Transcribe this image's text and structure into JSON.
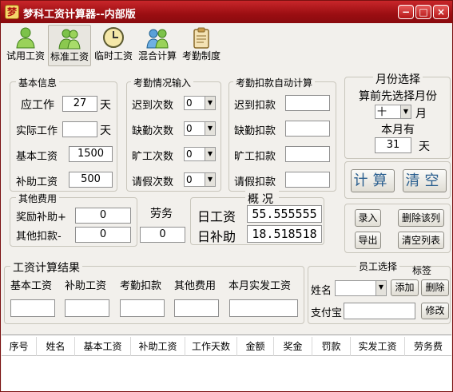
{
  "window": {
    "title": "梦科工资计算器--内部版",
    "app_icon_char": "梦",
    "controls": [
      "−",
      "□",
      "×"
    ]
  },
  "toolbar": [
    {
      "label": "试用工资",
      "icon": "person-icon"
    },
    {
      "label": "标准工资",
      "icon": "two-people-icon"
    },
    {
      "label": "临时工资",
      "icon": "clock-icon"
    },
    {
      "label": "混合计算",
      "icon": "people-group-icon"
    },
    {
      "label": "考勤制度",
      "icon": "clipboard-icon"
    }
  ],
  "basic": {
    "title": "基本信息",
    "work_days_label": "应工作",
    "work_days": "27",
    "day_unit": "天",
    "actual_label": "实际工作",
    "actual_value": "",
    "actual_unit": "天",
    "base_label": "基本工资",
    "base_value": "1500",
    "subsidy_label": "补助工资",
    "subsidy_value": "500"
  },
  "attendance": {
    "title": "考勤情况输入",
    "rows": [
      {
        "label": "迟到次数",
        "value": "0"
      },
      {
        "label": "缺勤次数",
        "value": "0"
      },
      {
        "label": "旷工次数",
        "value": "0"
      },
      {
        "label": "请假次数",
        "value": "0"
      }
    ]
  },
  "deduction": {
    "title": "考勤扣款自动计算",
    "rows": [
      {
        "label": "迟到扣款",
        "value": ""
      },
      {
        "label": "缺勤扣款",
        "value": ""
      },
      {
        "label": "旷工扣款",
        "value": ""
      },
      {
        "label": "请假扣款",
        "value": ""
      }
    ]
  },
  "month": {
    "title": "月份选择",
    "hint": "算前先选择月份",
    "month_value": "十",
    "month_unit": "月",
    "days_label": "本月有",
    "days_value": "31",
    "days_unit": "天"
  },
  "actions": {
    "calc": "计算",
    "clear": "清空"
  },
  "other": {
    "title": "其他费用",
    "bonus_label": "奖励补助+",
    "bonus_value": "0",
    "other_deduct_label": "其他扣款-",
    "other_deduct_value": "0"
  },
  "labor": {
    "label": "劳务",
    "value": "0"
  },
  "overview": {
    "title": "概况",
    "daily_wage_label": "日工资",
    "daily_wage_value": "55.555555",
    "daily_subsidy_label": "日补助",
    "daily_subsidy_value": "18.518518"
  },
  "record": {
    "enter": "录入",
    "delete_row": "删除该列",
    "export": "导出",
    "clear_list": "清空列表"
  },
  "result": {
    "title": "工资计算结果",
    "cols": [
      "基本工资",
      "补助工资",
      "考勤扣款",
      "其他费用",
      "本月实发工资"
    ]
  },
  "employee": {
    "title": "员工选择",
    "tag_label": "标签",
    "name_label": "姓名",
    "name_value": "",
    "add": "添加",
    "delete": "删除",
    "alipay_label": "支付宝",
    "alipay_value": "",
    "modify": "修改"
  },
  "table": {
    "columns": [
      "序号",
      "姓名",
      "基本工资",
      "补助工资",
      "工作天数",
      "金额",
      "奖金",
      "罚款",
      "实发工资",
      "劳务费"
    ]
  },
  "colors": {
    "title_bar": "#b01a1e",
    "window_bg": "#f2f0ec"
  }
}
